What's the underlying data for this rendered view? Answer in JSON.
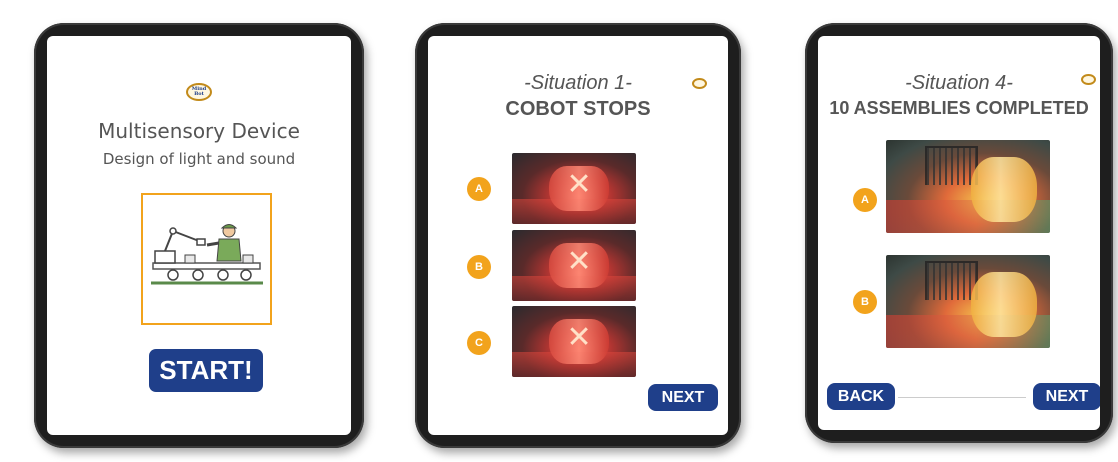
{
  "logo": {
    "line1": "Mind",
    "line2": "Bot"
  },
  "screen1": {
    "title": "Multisensory Device",
    "subtitle": "Design of light and sound",
    "start_label": "START!"
  },
  "screen2": {
    "situation": "-Situation 1-",
    "heading": "COBOT STOPS",
    "options": [
      "A",
      "B",
      "C"
    ],
    "next_label": "NEXT"
  },
  "screen3": {
    "situation": "-Situation 4-",
    "heading": "10 ASSEMBLIES COMPLETED",
    "options": [
      "A",
      "B"
    ],
    "back_label": "BACK",
    "next_label": "NEXT"
  },
  "colors": {
    "accent_orange": "#f2a31c",
    "button_blue": "#1f3f8a",
    "text_gray": "#555555",
    "bezel": "#1e1e1e"
  }
}
